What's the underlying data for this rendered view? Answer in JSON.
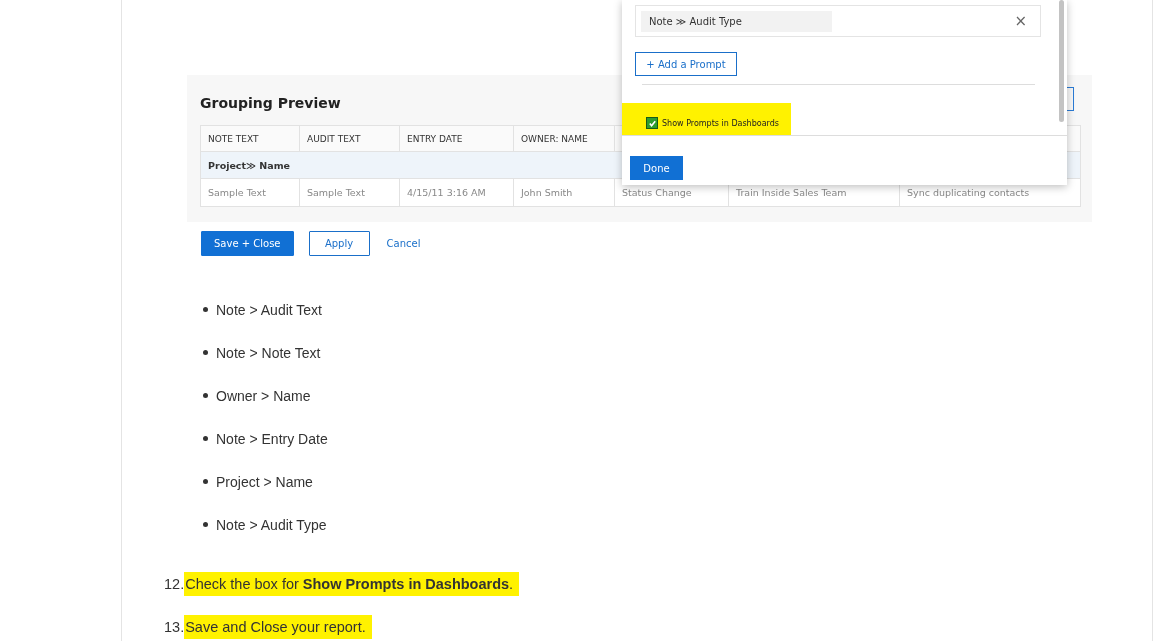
{
  "grouping_preview": {
    "title": "Grouping Preview",
    "columns": [
      "NOTE TEXT",
      "AUDIT TEXT",
      "ENTRY DATE",
      "OWNER: NAME"
    ],
    "group_row": "Project≫ Name",
    "rows": [
      [
        "Sample Text",
        "Sample Text",
        "4/15/11 3:16 AM",
        "John Smith",
        "Status Change",
        "Train Inside Sales Team",
        "Sync duplicating contacts"
      ]
    ],
    "buttons": [
      {
        "label": "Save + Close",
        "kind": "primary"
      },
      {
        "label": "Apply",
        "kind": "outline"
      },
      {
        "label": "Cancel",
        "kind": "link"
      }
    ]
  },
  "prompt_dialog": {
    "chip": "Note ≫ Audit Type",
    "remove": "×",
    "add_button": "+ Add a Prompt",
    "checkbox": {
      "label": "Show Prompts in Dashboards",
      "checked": true,
      "highlighted": true
    },
    "done_button": "Done"
  },
  "bullets": [
    "Note > Audit Text",
    "Note > Note Text",
    "Owner > Name",
    "Note > Entry Date",
    "Project > Name",
    "Note > Audit Type"
  ],
  "steps": [
    {
      "number": "12.",
      "text": "Check the box for **Show Prompts in Dashboards**.",
      "highlighted": true
    },
    {
      "number": "13.",
      "text": "Save and Close your report.",
      "highlighted": true
    }
  ]
}
